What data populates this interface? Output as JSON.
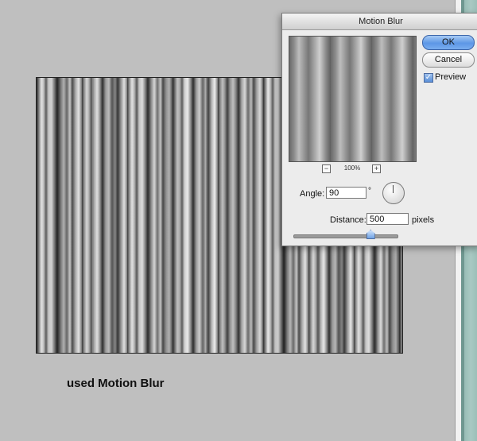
{
  "caption": "used Motion Blur",
  "dialog": {
    "title": "Motion Blur",
    "ok_label": "OK",
    "cancel_label": "Cancel",
    "preview_label": "Preview",
    "preview_checked": true,
    "zoom_level": "100%",
    "zoom_minus": "−",
    "zoom_plus": "+",
    "angle_label": "Angle:",
    "angle_value": "90",
    "degree_symbol": "°",
    "distance_label": "Distance:",
    "distance_value": "500",
    "distance_unit": "pixels",
    "distance_slider_fraction": 0.74
  },
  "colors": {
    "background": "#bfbfbf",
    "ok_button": "#5d97e6",
    "dialog": "#ececec"
  }
}
